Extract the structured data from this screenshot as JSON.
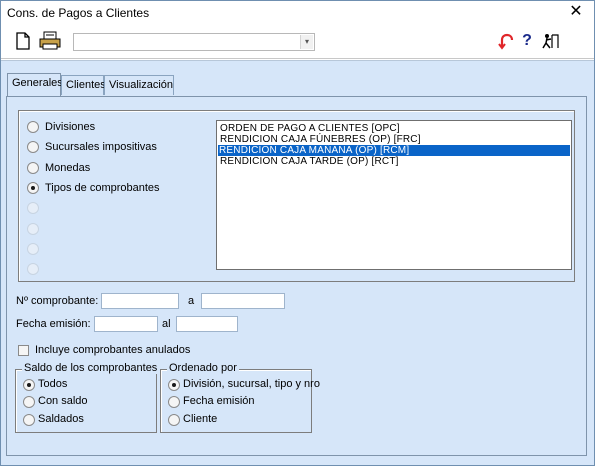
{
  "window": {
    "title": "Cons. de Pagos a Clientes",
    "close_glyph": "✕"
  },
  "toolbar": {
    "new_icon": "new-document-icon",
    "print_icon": "printer-icon",
    "combo_value": "",
    "help_glyph": "?",
    "red_icon": "undo-arrow-icon",
    "exit_icon": "exit-icon"
  },
  "tabs": [
    "Generales",
    "Clientes",
    "Visualización"
  ],
  "selector": {
    "options": [
      {
        "label": "Divisiones",
        "checked": false,
        "enabled": true
      },
      {
        "label": "Sucursales impositivas",
        "checked": false,
        "enabled": true
      },
      {
        "label": "Monedas",
        "checked": false,
        "enabled": true
      },
      {
        "label": "Tipos de comprobantes",
        "checked": true,
        "enabled": true
      },
      {
        "label": "",
        "checked": false,
        "enabled": false
      },
      {
        "label": "",
        "checked": false,
        "enabled": false
      },
      {
        "label": "",
        "checked": false,
        "enabled": false
      },
      {
        "label": "",
        "checked": false,
        "enabled": false
      }
    ],
    "list_items": [
      {
        "text": "ORDEN DE PAGO A CLIENTES  [OPC]",
        "selected": false
      },
      {
        "text": "RENDICION CAJA FÚNEBRES (OP)  [FRC]",
        "selected": false
      },
      {
        "text": "RENDICION CAJA MAÑANA (OP)  [RCM]",
        "selected": true
      },
      {
        "text": "RENDICION CAJA TARDE (OP)  [RCT]",
        "selected": false
      }
    ]
  },
  "filters": {
    "comprobante_label": "Nº comprobante:",
    "comprobante_from": "",
    "comprobante_to_label": "a",
    "comprobante_to": "",
    "fecha_label": "Fecha emisión:",
    "fecha_from": "",
    "fecha_to_label": "al",
    "fecha_to": "",
    "anulados_label": "Incluye comprobantes anulados",
    "anulados_checked": false
  },
  "saldo": {
    "legend": "Saldo de los comprobantes",
    "options": [
      "Todos",
      "Con saldo",
      "Saldados"
    ],
    "selected": 0
  },
  "orden": {
    "legend": "Ordenado por",
    "options": [
      "División, sucursal, tipo y nro",
      "Fecha emisión",
      "Cliente"
    ],
    "selected": 0
  },
  "colors": {
    "accent": "#0a64c8",
    "panel_bg": "#d6e6f9"
  }
}
